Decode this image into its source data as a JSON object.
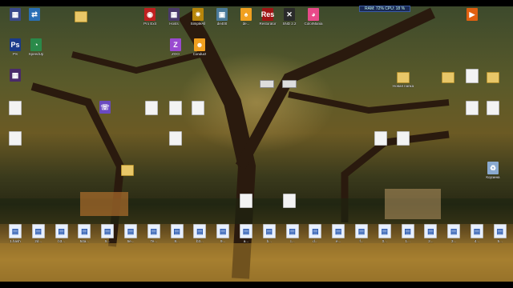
{
  "perf": {
    "text": "RAM: 72% CPU: 18 %"
  },
  "icons": [
    {
      "id": "mytv",
      "label": "",
      "glyph": "▦",
      "color": "#3a4a8c"
    },
    {
      "id": "net",
      "label": "",
      "glyph": "⇄",
      "color": "#2a6fb5"
    },
    {
      "id": "f1",
      "label": "",
      "glyph": "",
      "color": "#e8c768"
    },
    {
      "id": "exit",
      "label": "Pro Exit",
      "glyph": "◉",
      "color": "#c02020"
    },
    {
      "id": "aimp",
      "label": "Hosts",
      "glyph": "▦",
      "color": "#4a3a6a"
    },
    {
      "id": "simple",
      "label": "SimpleAll",
      "glyph": "✷",
      "color": "#b8860b"
    },
    {
      "id": "de",
      "label": "de400",
      "glyph": "▣",
      "color": "#4a7a9a"
    },
    {
      "id": "fsresto",
      "label": "de...",
      "glyph": "♠",
      "color": "#f0a020"
    },
    {
      "id": "res",
      "label": "Restorator",
      "glyph": "Res",
      "color": "#a01515"
    },
    {
      "id": "snd",
      "label": "SND 2.2",
      "glyph": "✕",
      "color": "#2a2a2a"
    },
    {
      "id": "color",
      "label": "ColorMania",
      "glyph": "◕",
      "color": "#e84a8a"
    },
    {
      "id": "ps",
      "label": "PS",
      "glyph": "Ps",
      "color": "#1a3a8a"
    },
    {
      "id": "speed",
      "label": "SpeedUp",
      "glyph": "◔",
      "color": "#2a8a4a"
    },
    {
      "id": "hex",
      "label": "",
      "glyph": "▦",
      "color": "#4a2a6a"
    },
    {
      "id": "zoo",
      "label": "ZOO",
      "glyph": "Z",
      "color": "#9a4ad0"
    },
    {
      "id": "conduct",
      "label": "Conduct",
      "glyph": "☻",
      "color": "#f0a020"
    },
    {
      "id": "r1",
      "label": "",
      "glyph": "▶",
      "color": "#e06010"
    },
    {
      "id": "d1",
      "label": "",
      "glyph": "",
      "color": "#f3f3f3"
    },
    {
      "id": "d2",
      "label": "",
      "glyph": "",
      "color": "#f3f3f3"
    },
    {
      "id": "d3",
      "label": "",
      "glyph": "",
      "color": "#f3f3f3"
    },
    {
      "id": "d4",
      "label": "",
      "glyph": "",
      "color": "#f3f3f3"
    },
    {
      "id": "d5",
      "label": "",
      "glyph": "",
      "color": "#f3f3f3"
    },
    {
      "id": "d6",
      "label": "",
      "glyph": "",
      "color": "#f3f3f3"
    },
    {
      "id": "hotline",
      "label": "",
      "glyph": "☏",
      "color": "#6a4ac0"
    },
    {
      "id": "drive1",
      "label": "",
      "glyph": "",
      "color": "#ddd"
    },
    {
      "id": "drive2",
      "label": "",
      "glyph": "",
      "color": "#ddd"
    },
    {
      "id": "fold",
      "label": "Новая папка",
      "glyph": "",
      "color": "#e8c768"
    },
    {
      "id": "fold2",
      "label": "",
      "glyph": "",
      "color": "#e8c768"
    },
    {
      "id": "fold3",
      "label": "",
      "glyph": "",
      "color": "#e8c768"
    },
    {
      "id": "d7",
      "label": "",
      "glyph": "",
      "color": "#f3f3f3"
    },
    {
      "id": "d8",
      "label": "",
      "glyph": "",
      "color": "#f3f3f3"
    },
    {
      "id": "d9",
      "label": "",
      "glyph": "",
      "color": "#f3f3f3"
    },
    {
      "id": "recycle",
      "label": "Корзина",
      "glyph": "♻",
      "color": "#8aaad0"
    },
    {
      "id": "d10",
      "label": "",
      "glyph": "",
      "color": "#f3f3f3"
    },
    {
      "id": "d11",
      "label": "",
      "glyph": "",
      "color": "#f3f3f3"
    },
    {
      "id": "dpic",
      "label": "",
      "glyph": "",
      "color": "#e8c768"
    },
    {
      "id": "d12",
      "label": "",
      "glyph": "",
      "color": "#f3f3f3"
    },
    {
      "id": "d13",
      "label": "",
      "glyph": "",
      "color": "#f3f3f3"
    }
  ],
  "bottom_row": [
    {
      "label": "1.hash"
    },
    {
      "label": "2d..."
    },
    {
      "label": "b3..."
    },
    {
      "label": "54a..."
    },
    {
      "label": "5..."
    },
    {
      "label": "6e..."
    },
    {
      "label": "7e..."
    },
    {
      "label": "8..."
    },
    {
      "label": "b3..."
    },
    {
      "label": "9..."
    },
    {
      "label": "a..."
    },
    {
      "label": "b..."
    },
    {
      "label": "c..."
    },
    {
      "label": "d..."
    },
    {
      "label": "e..."
    },
    {
      "label": "f..."
    },
    {
      "label": "0..."
    },
    {
      "label": "1..."
    },
    {
      "label": "2..."
    },
    {
      "label": "3..."
    },
    {
      "label": "4..."
    },
    {
      "label": "5..."
    }
  ]
}
